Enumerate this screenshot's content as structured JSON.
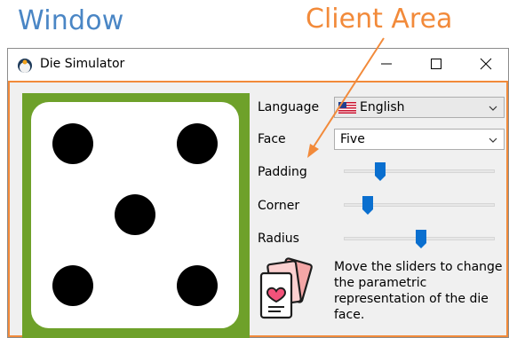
{
  "annotations": {
    "window_label": "Window",
    "client_label": "Client Area",
    "window_color": "#4a86c5",
    "client_color": "#f28a3a"
  },
  "window": {
    "title": "Die Simulator",
    "icon": "die-app-icon",
    "controls": [
      "minimize-icon",
      "maximize-icon",
      "close-icon"
    ]
  },
  "die": {
    "face_value": 5,
    "background_color": "#6ea12a",
    "face_color": "#ffffff",
    "pip_color": "#000000"
  },
  "form": {
    "language_label": "Language",
    "language_value": "English",
    "language_flag": "us-flag-icon",
    "face_label": "Face",
    "face_value": "Five",
    "padding_label": "Padding",
    "padding_value": 0.22,
    "corner_label": "Corner",
    "corner_value": 0.13,
    "radius_label": "Radius",
    "radius_value": 0.51,
    "info_line1": "Move the sliders to change",
    "info_line2": "the parametric",
    "info_line3": "representation of the die",
    "info_line4": "face.",
    "info_icon": "cards-heart-icon",
    "slider_accent": "#0a6fcf"
  }
}
